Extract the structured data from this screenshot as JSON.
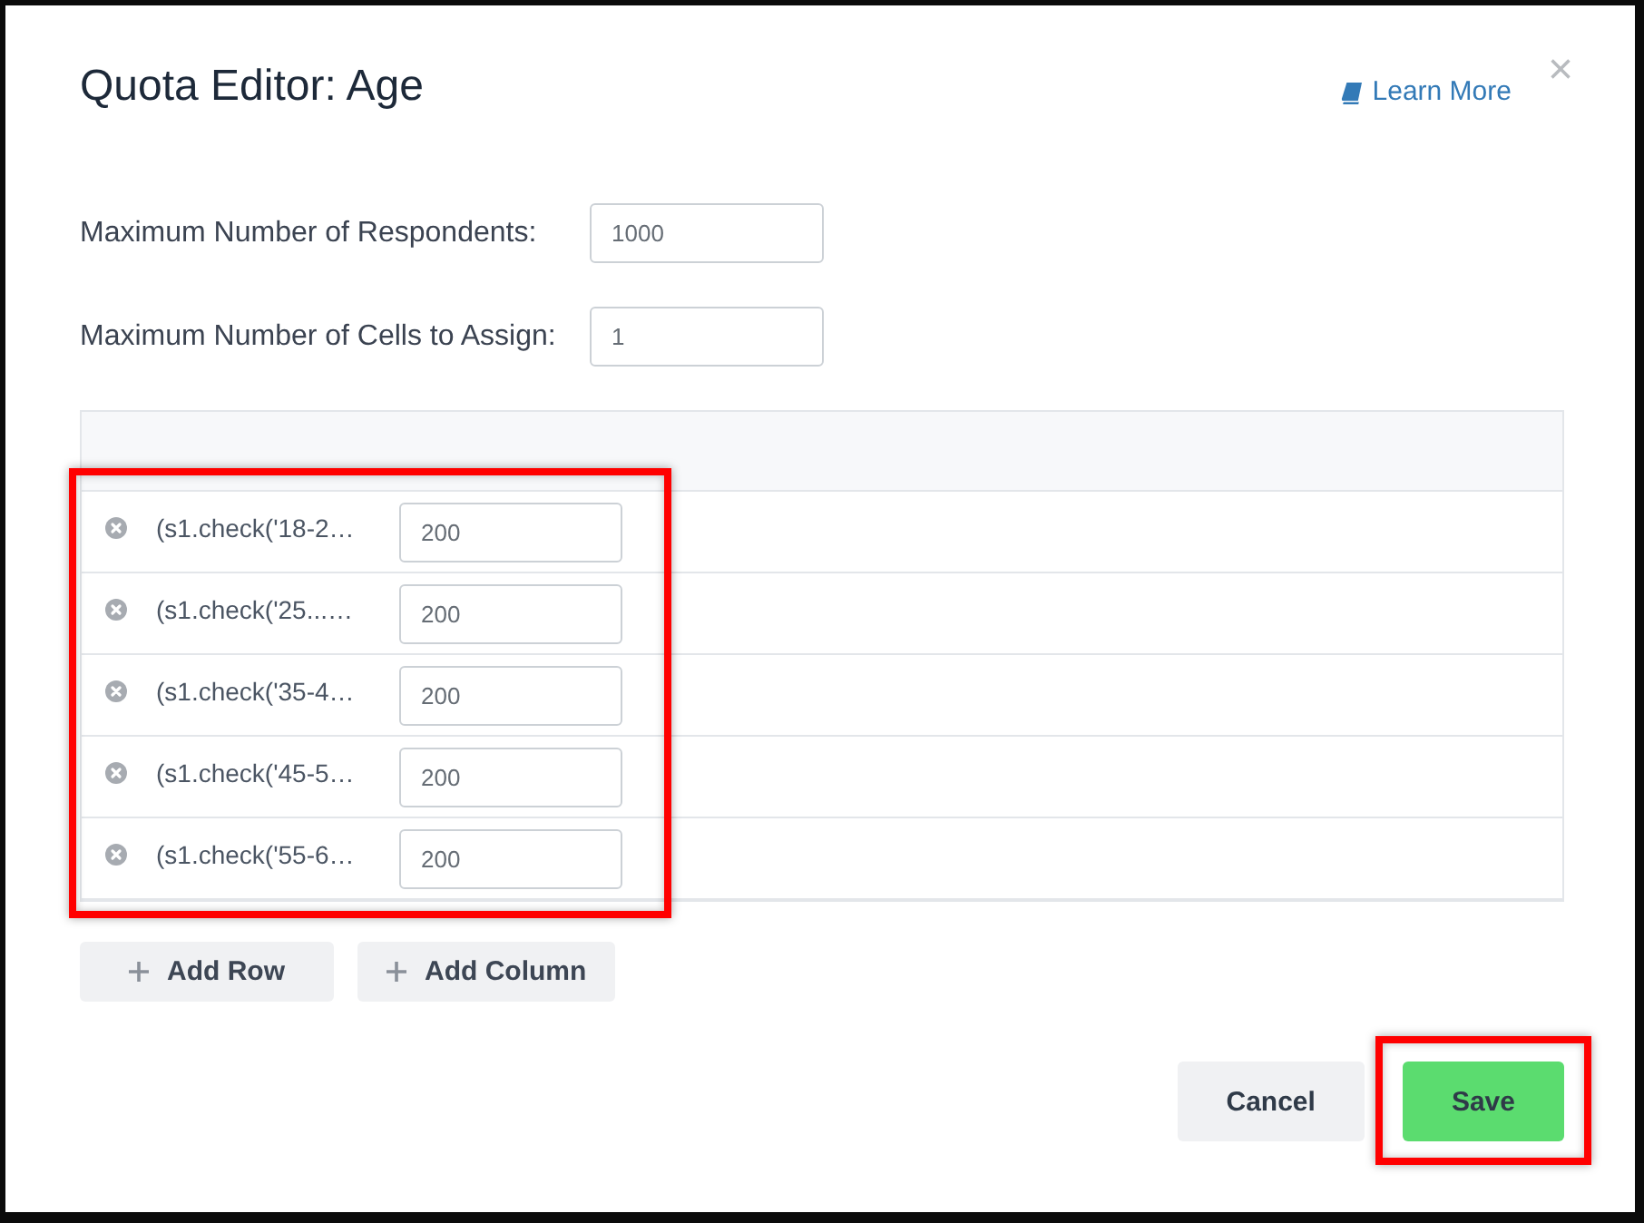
{
  "dialog": {
    "title": "Quota Editor: Age",
    "help_link": "Learn More",
    "close": "×"
  },
  "fields": [
    {
      "label": "Maximum Number of Respondents:",
      "value": "1000"
    },
    {
      "label": "Maximum Number of Cells to Assign:",
      "value": "1"
    }
  ],
  "quota_table": {
    "highlighted": true,
    "rows": [
      {
        "condition": "(s1.check('18-2…",
        "value": "200"
      },
      {
        "condition": "(s1.check('25...…",
        "value": "200"
      },
      {
        "condition": "(s1.check('35-4…",
        "value": "200"
      },
      {
        "condition": "(s1.check('45-5…",
        "value": "200"
      },
      {
        "condition": "(s1.check('55-6…",
        "value": "200"
      }
    ]
  },
  "table_actions": [
    {
      "label": "Add Row"
    },
    {
      "label": "Add Column"
    }
  ],
  "footer_buttons": [
    {
      "label": "Cancel",
      "kind": "secondary",
      "highlighted": false
    },
    {
      "label": "Save",
      "kind": "primary",
      "highlighted": true
    }
  ]
}
